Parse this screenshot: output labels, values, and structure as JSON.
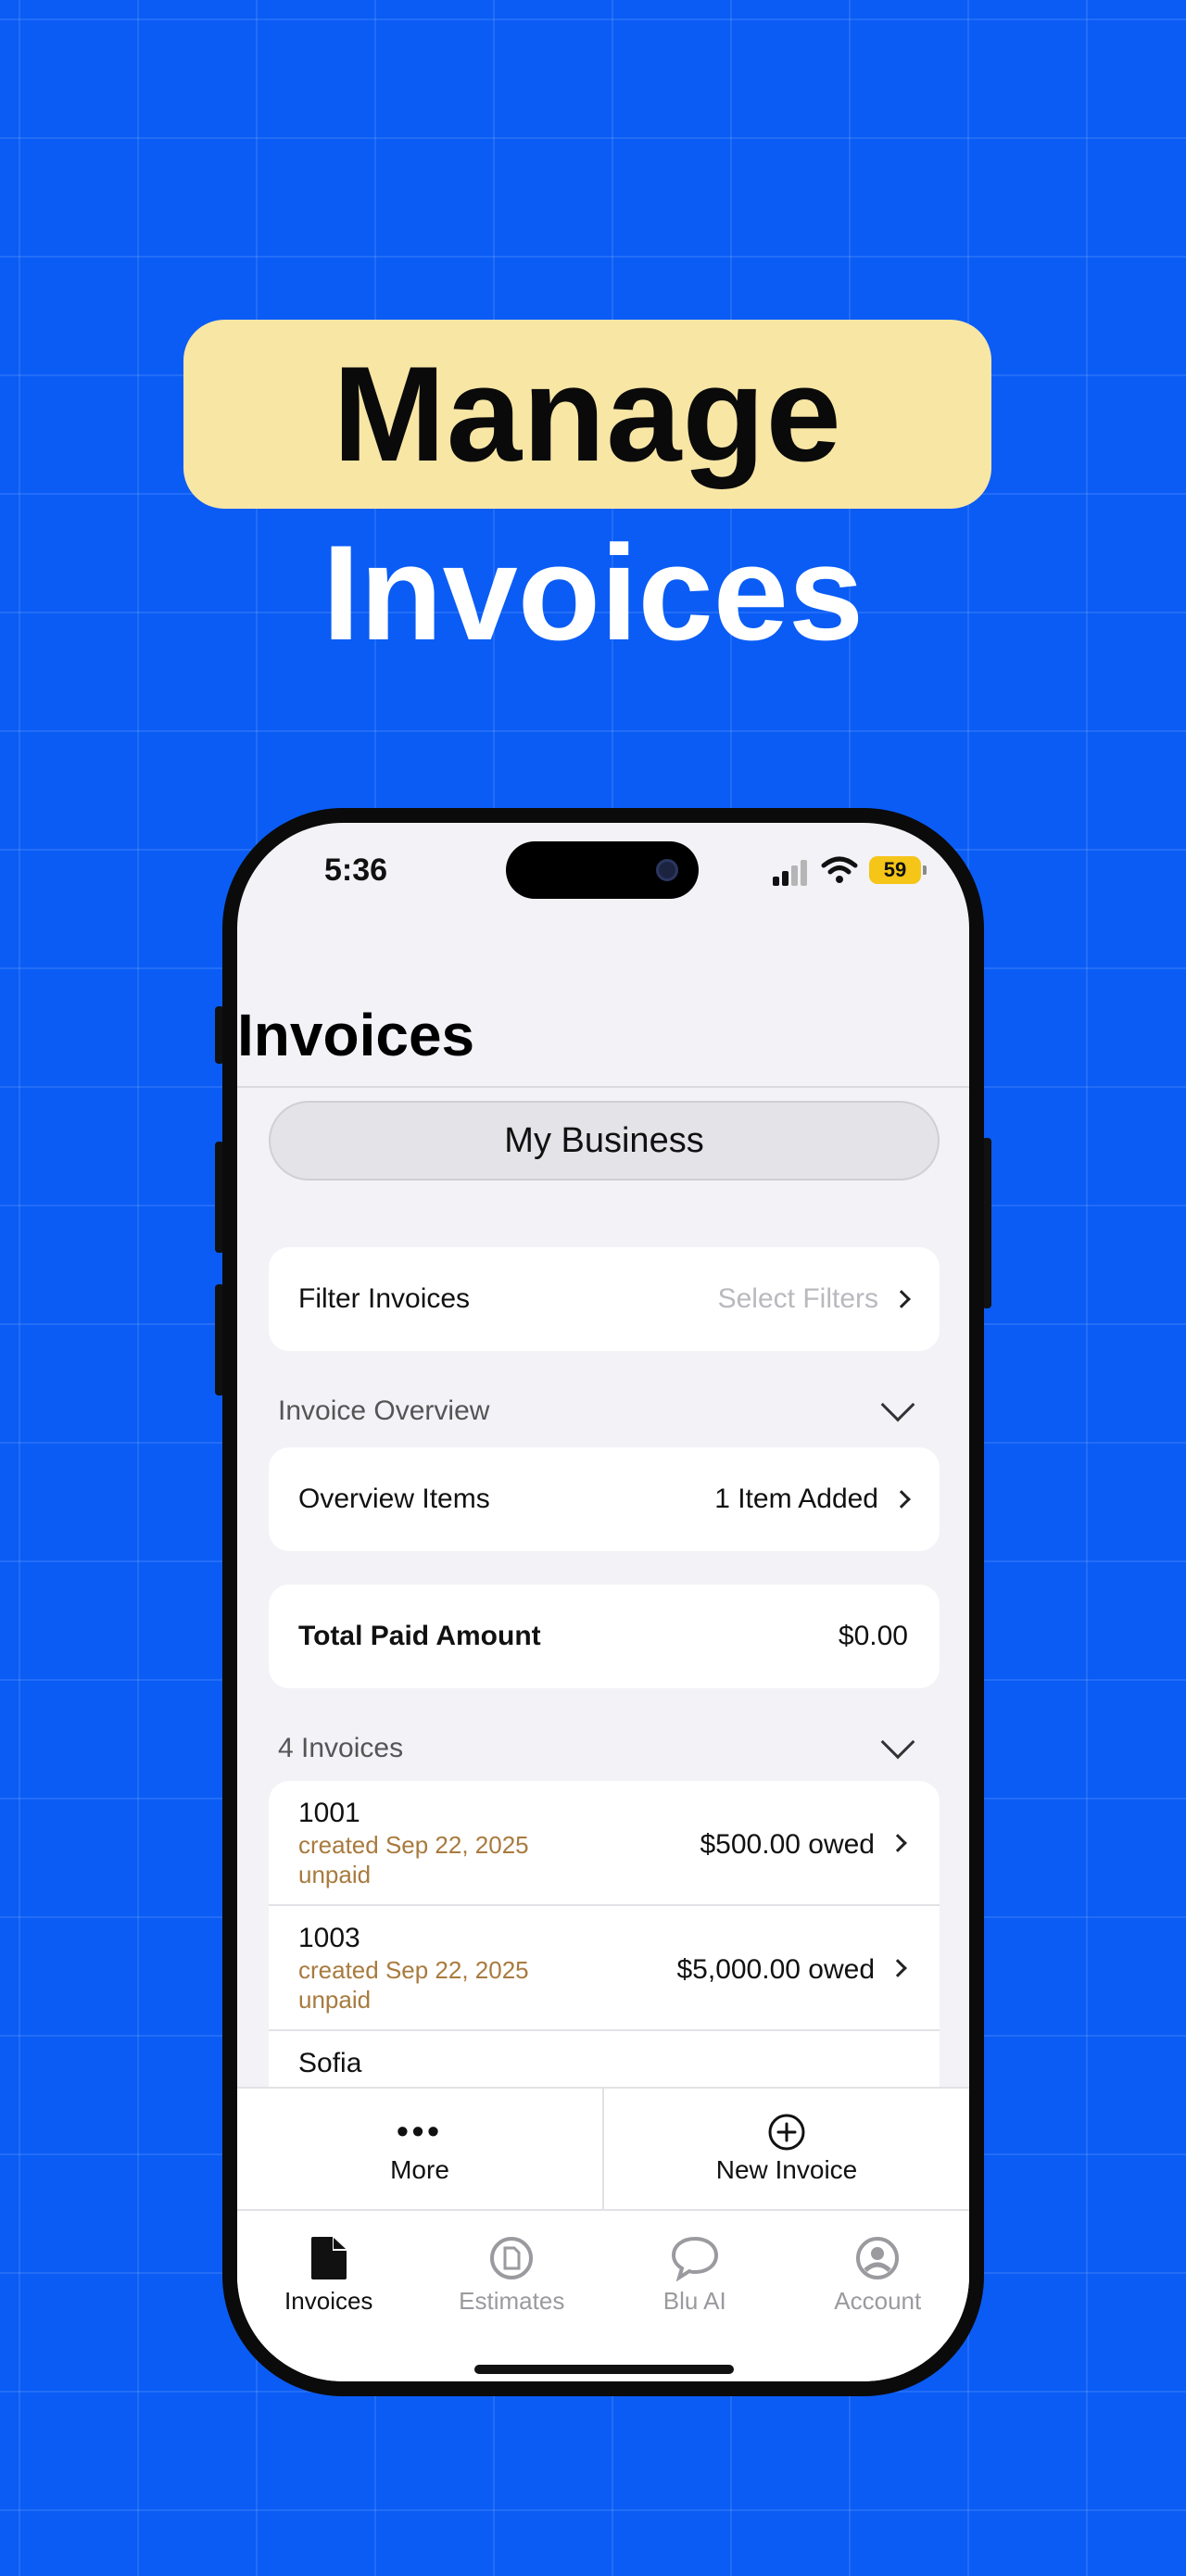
{
  "promo": {
    "headline": "Manage",
    "subheadline": "Invoices"
  },
  "status_bar": {
    "time": "5:36",
    "battery": "59"
  },
  "page": {
    "title": "Invoices",
    "business": "My Business"
  },
  "filter": {
    "label": "Filter Invoices",
    "value": "Select Filters"
  },
  "overview": {
    "header": "Invoice Overview",
    "items_label": "Overview Items",
    "items_value": "1 Item Added"
  },
  "total": {
    "label": "Total Paid Amount",
    "value": "$0.00"
  },
  "invoices": {
    "header": "4 Invoices",
    "items": [
      {
        "number": "1001",
        "created": "created Sep 22, 2025",
        "status": "unpaid",
        "amount": "$500.00 owed"
      },
      {
        "number": "1003",
        "created": "created Sep 22, 2025",
        "status": "unpaid",
        "amount": "$5,000.00 owed"
      },
      {
        "number": "Sofia",
        "created": "",
        "status": "",
        "amount": ""
      }
    ]
  },
  "actions": {
    "more": "More",
    "new_invoice": "New Invoice"
  },
  "tabs": [
    {
      "label": "Invoices",
      "icon": "document-icon",
      "active": true
    },
    {
      "label": "Estimates",
      "icon": "estimate-icon",
      "active": false
    },
    {
      "label": "Blu AI",
      "icon": "chat-bubble-icon",
      "active": false
    },
    {
      "label": "Account",
      "icon": "person-icon",
      "active": false
    }
  ],
  "colors": {
    "background": "#0a5cf5",
    "pill": "#f8e6a5",
    "unpaid_text": "#a87a3e"
  }
}
